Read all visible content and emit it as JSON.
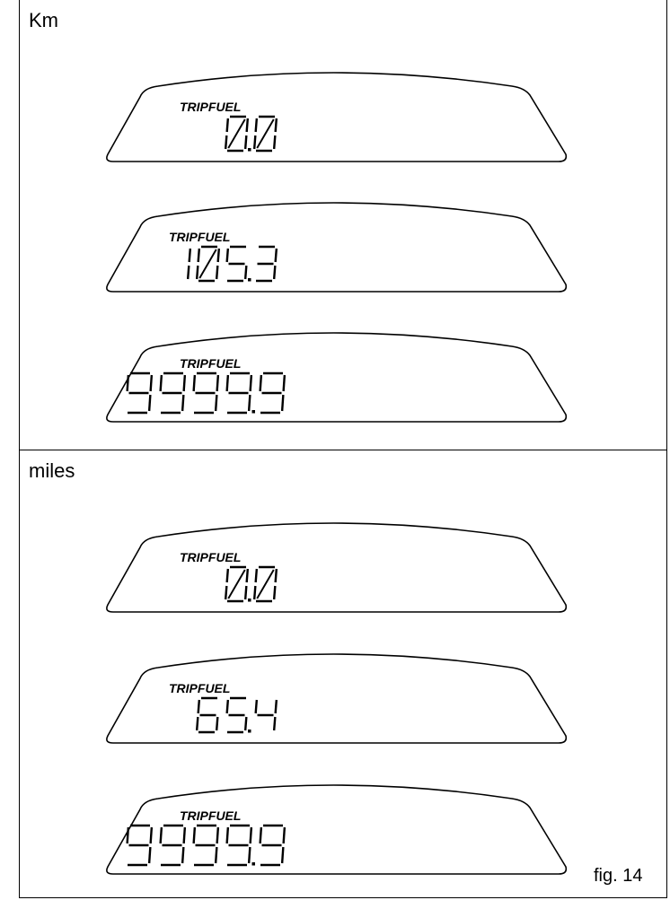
{
  "sections": [
    {
      "unit": "Km",
      "displays": [
        {
          "label": "TRIPFUEL",
          "value": "0.0"
        },
        {
          "label": "TRIPFUEL",
          "value": "105.3"
        },
        {
          "label": "TRIPFUEL",
          "value": "9999.9"
        }
      ]
    },
    {
      "unit": "miles",
      "displays": [
        {
          "label": "TRIPFUEL",
          "value": "0.0"
        },
        {
          "label": "TRIPFUEL",
          "value": "65.4"
        },
        {
          "label": "TRIPFUEL",
          "value": "9999.9"
        }
      ]
    }
  ],
  "figure_label": "fig. 14"
}
